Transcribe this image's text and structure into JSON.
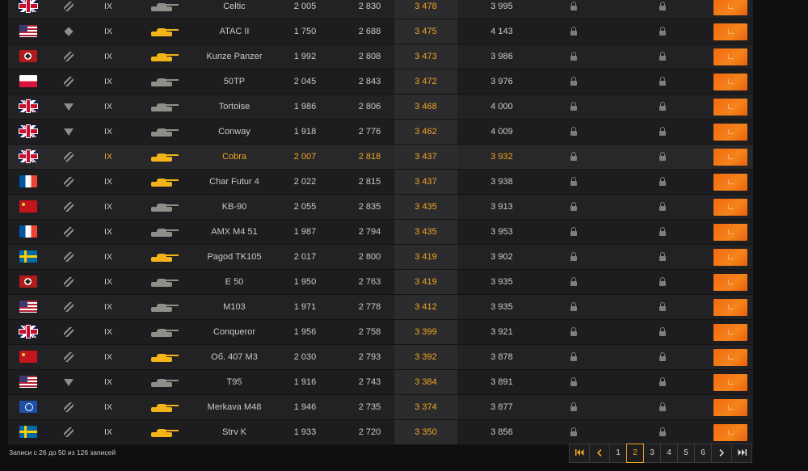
{
  "rows": [
    {
      "flag": "uk",
      "type": "medium",
      "tier": "IX",
      "tank": "grey",
      "name": "Celtic",
      "n1": "2 005",
      "n2": "2 830",
      "n3": "3 478",
      "n4": "3 995"
    },
    {
      "flag": "usa",
      "type": "diamond",
      "tier": "IX",
      "tank": "gold",
      "name": "ATAC II",
      "n1": "1 750",
      "n2": "2 688",
      "n3": "3 475",
      "n4": "4 143"
    },
    {
      "flag": "ger",
      "type": "medium",
      "tier": "IX",
      "tank": "gold",
      "name": "Kunze Panzer",
      "n1": "1 992",
      "n2": "2 808",
      "n3": "3 473",
      "n4": "3 986"
    },
    {
      "flag": "pol",
      "type": "medium",
      "tier": "IX",
      "tank": "grey",
      "name": "50TP",
      "n1": "2 045",
      "n2": "2 843",
      "n3": "3 472",
      "n4": "3 976"
    },
    {
      "flag": "uk",
      "type": "triangle",
      "tier": "IX",
      "tank": "grey",
      "name": "Tortoise",
      "n1": "1 986",
      "n2": "2 806",
      "n3": "3 468",
      "n4": "4 000"
    },
    {
      "flag": "uk",
      "type": "triangle",
      "tier": "IX",
      "tank": "grey",
      "name": "Conway",
      "n1": "1 918",
      "n2": "2 776",
      "n3": "3 462",
      "n4": "4 009"
    },
    {
      "flag": "uk",
      "type": "medium",
      "tier": "IX",
      "tank": "gold",
      "name": "Cobra",
      "n1": "2 007",
      "n2": "2 818",
      "n3": "3 437",
      "n4": "3 932",
      "hl": true
    },
    {
      "flag": "fra",
      "type": "medium",
      "tier": "IX",
      "tank": "gold",
      "name": "Char Futur 4",
      "n1": "2 022",
      "n2": "2 815",
      "n3": "3 437",
      "n4": "3 938"
    },
    {
      "flag": "ussr",
      "type": "medium",
      "tier": "IX",
      "tank": "grey",
      "name": "KB-90",
      "n1": "2 055",
      "n2": "2 835",
      "n3": "3 435",
      "n4": "3 913"
    },
    {
      "flag": "fra",
      "type": "medium",
      "tier": "IX",
      "tank": "grey",
      "name": "AMX M4 51",
      "n1": "1 987",
      "n2": "2 794",
      "n3": "3 435",
      "n4": "3 953"
    },
    {
      "flag": "swe",
      "type": "medium",
      "tier": "IX",
      "tank": "gold",
      "name": "Pagod TK105",
      "n1": "2 017",
      "n2": "2 800",
      "n3": "3 419",
      "n4": "3 902"
    },
    {
      "flag": "ger",
      "type": "medium",
      "tier": "IX",
      "tank": "grey",
      "name": "E 50",
      "n1": "1 950",
      "n2": "2 763",
      "n3": "3 419",
      "n4": "3 935"
    },
    {
      "flag": "usa",
      "type": "medium",
      "tier": "IX",
      "tank": "grey",
      "name": "M103",
      "n1": "1 971",
      "n2": "2 778",
      "n3": "3 412",
      "n4": "3 935"
    },
    {
      "flag": "uk",
      "type": "medium",
      "tier": "IX",
      "tank": "grey",
      "name": "Conqueror",
      "n1": "1 956",
      "n2": "2 758",
      "n3": "3 399",
      "n4": "3 921"
    },
    {
      "flag": "ussr",
      "type": "medium",
      "tier": "IX",
      "tank": "gold",
      "name": "Об. 407 M3",
      "n1": "2 030",
      "n2": "2 793",
      "n3": "3 392",
      "n4": "3 878"
    },
    {
      "flag": "usa",
      "type": "triangle",
      "tier": "IX",
      "tank": "grey",
      "name": "T95",
      "n1": "1 916",
      "n2": "2 743",
      "n3": "3 384",
      "n4": "3 891"
    },
    {
      "flag": "isr",
      "type": "medium",
      "tier": "IX",
      "tank": "gold",
      "name": "Merkava M48",
      "n1": "1 946",
      "n2": "2 735",
      "n3": "3 374",
      "n4": "3 877"
    },
    {
      "flag": "swe",
      "type": "medium",
      "tier": "IX",
      "tank": "gold",
      "name": "Strv K",
      "n1": "1 933",
      "n2": "2 720",
      "n3": "3 350",
      "n4": "3 856"
    }
  ],
  "footer": {
    "info": "Записи с 26 до 50 из 126 записей"
  },
  "pagination": {
    "pages": [
      "1",
      "2",
      "3",
      "4",
      "5",
      "6"
    ],
    "active": "2"
  },
  "colors": {
    "accent": "#f2a523",
    "button": "#f5841c",
    "bg": "#0f0f10"
  }
}
